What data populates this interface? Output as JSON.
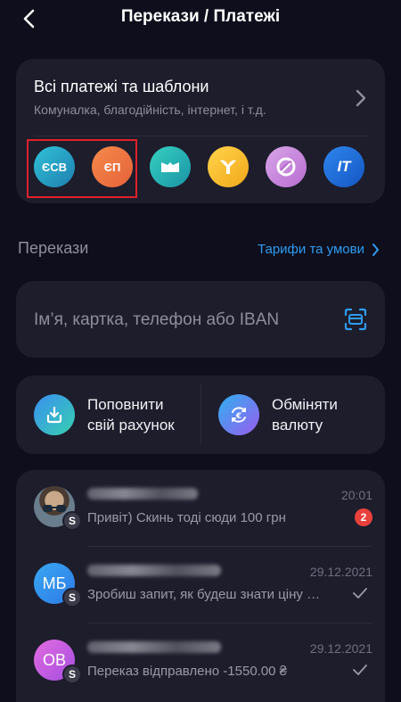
{
  "header": {
    "title": "Перекази / Платежі"
  },
  "payments": {
    "title": "Всі платежі та шаблони",
    "subtitle": "Комуналка, благодійність, інтернет, і т.д.",
    "shortcuts": [
      {
        "label": "ЄСВ",
        "icon": "esv-icon"
      },
      {
        "label": "ЄП",
        "icon": "ep-icon"
      },
      {
        "label": "",
        "icon": "wallet-icon"
      },
      {
        "label": "",
        "icon": "kyivstar-icon"
      },
      {
        "label": "",
        "icon": "lifecell-icon"
      },
      {
        "label": "IT",
        "icon": "it-icon"
      }
    ]
  },
  "transfers": {
    "section_label": "Перекази",
    "tariffs_link": "Тарифи та умови",
    "search_placeholder": "Ім’я, картка, телефон або IBAN"
  },
  "actions": {
    "topup_label": "Поповнити\nсвій рахунок",
    "exchange_label": "Обміняти\nвалюту"
  },
  "chats": [
    {
      "avatar_initials": "",
      "badge": "S",
      "time": "20:01",
      "message": "Привіт) Скинь тоді сюди 100 грн",
      "unread": "2"
    },
    {
      "avatar_initials": "МБ",
      "badge": "S",
      "time": "29.12.2021",
      "message": "Зробиш запит, як будеш знати ціну за...",
      "status": "read"
    },
    {
      "avatar_initials": "ОВ",
      "badge": "S",
      "time": "29.12.2021",
      "message": "Переказ відправлено -1550.00 ₴",
      "status": "read"
    }
  ],
  "colors": {
    "background": "#0e0e1c",
    "card": "#1d1d2c",
    "accent_blue": "#2f9cf2",
    "unread_badge": "#e8413c",
    "selection_box": "#e0202a"
  }
}
